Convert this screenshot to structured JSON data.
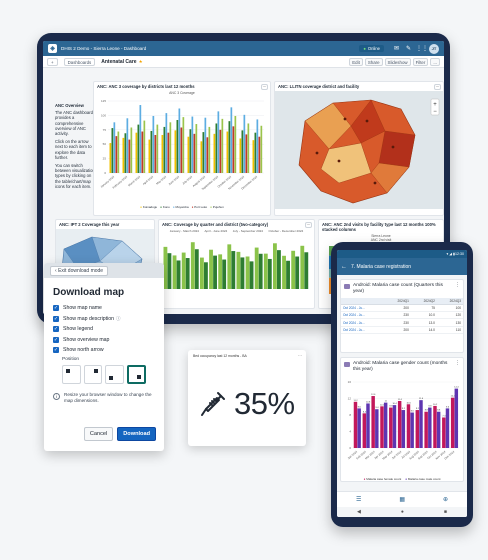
{
  "tablet": {
    "app_title": "DHIS 2 Demo - Sierra Leone - Dashboard",
    "online_label": "Online",
    "avatar_initials": "JT",
    "dashboards_btn": "Dashboards",
    "dashboard_name": "Antenatal Care",
    "actions": [
      "Edit",
      "Share",
      "Slideshow",
      "Filter",
      "..."
    ],
    "intro": {
      "heading": "ANC Overview",
      "paragraphs": [
        "The ANC dashboard provides a comprehensive overview of ANC activity.",
        "Click on the arrow next to each item to explore the data further.",
        "You can switch between visualization types by clicking on the table/chart/map icons for each item."
      ]
    },
    "cards": {
      "anc3_title": "ANC: ANC 3 coverage by districts last 12 months",
      "anc3_subtitle": "ANC 3 Coverage",
      "anc3_legend": [
        "Koinadugu",
        "Kono",
        "Moyamba",
        "Port Loko",
        "Pujehun"
      ],
      "map_title": "ANC: LLITN coverage district and facility",
      "ipt_title": "ANC: IPT 2 Coverage this year",
      "quarter_title": "ANC: Coverage by quarter and district (two-category)",
      "quarter_periods": [
        "January - March 2024",
        "April - June 2024",
        "July - September 2024",
        "October - December 2024"
      ],
      "visits_title": "ANC: ANC 2nd visits by facility type last 12 months 100% stacked columns",
      "visits_subtitle": "Sierra Leone",
      "visits_subtitle2": "ANC 2nd visit"
    }
  },
  "download_dialog": {
    "exit_label": "Exit download mode",
    "title": "Download map",
    "options": [
      "Show map name",
      "Show map description",
      "Show legend",
      "Show overview map",
      "Show north arrow"
    ],
    "position_label": "Position",
    "note": "Resize your browser window to change the map dimensions.",
    "cancel_label": "Cancel",
    "download_label": "Download"
  },
  "single_value": {
    "title": "Bed occupancy last 12 months - BA",
    "value": "35%"
  },
  "phone": {
    "time": "12:30",
    "screen_title": "7. Malaria case registration",
    "table_card_title": "Android: Malaria case count (Quarters this year)",
    "table_headers": [
      "",
      "2024Q1",
      "2024Q2",
      "2024Q3"
    ],
    "table_rows": [
      [
        "Oct 2024 - Ju...",
        "200",
        "75",
        "100"
      ],
      [
        "Oct 2024 - Ju...",
        "230",
        "10.0",
        "120"
      ],
      [
        "Oct 2024 - Ju...",
        "230",
        "13.0",
        "130"
      ],
      [
        "Oct 2024 - Ju...",
        "200",
        "14.0",
        "110"
      ]
    ],
    "chart_card_title": "Android: Malaria case gender count (months this year)",
    "chart_legend": [
      "Malaria case female count",
      "Malaria case male count"
    ]
  },
  "chart_data": [
    {
      "type": "bar",
      "title": "ANC: ANC 3 coverage by districts last 12 months",
      "subtitle": "ANC 3 Coverage",
      "categories": [
        "January 2024",
        "February 2024",
        "March 2024",
        "April 2024",
        "May 2024",
        "June 2024",
        "July 2024",
        "August 2024",
        "September 2024",
        "October 2024",
        "November 2024",
        "December 2024"
      ],
      "series": [
        {
          "name": "Koinadugu",
          "values": [
            52,
            61,
            70,
            58,
            66,
            74,
            63,
            55,
            68,
            72,
            60,
            57
          ]
        },
        {
          "name": "Kono",
          "values": [
            78,
            69,
            84,
            73,
            80,
            92,
            76,
            71,
            86,
            90,
            74,
            70
          ]
        },
        {
          "name": "Moyamba",
          "values": [
            88,
            95,
            118,
            99,
            104,
            112,
            98,
            96,
            107,
            114,
            101,
            93
          ]
        },
        {
          "name": "Port Loko",
          "values": [
            64,
            58,
            72,
            66,
            70,
            79,
            68,
            62,
            75,
            81,
            67,
            63
          ]
        },
        {
          "name": "Pujehun",
          "values": [
            72,
            79,
            91,
            84,
            88,
            97,
            85,
            80,
            94,
            99,
            86,
            82
          ]
        }
      ],
      "ylim": [
        0,
        125
      ]
    },
    {
      "type": "bar",
      "title": "Android: Malaria case gender count (months this year)",
      "categories": [
        "Jan 2024",
        "Feb 2024",
        "Mar 2024",
        "Apr 2024",
        "May 2024",
        "Jun 2024",
        "Jul 2024",
        "Aug 2024",
        "Sep 2024",
        "Oct 2024",
        "Nov 2024",
        "Dec 2024"
      ],
      "series": [
        {
          "name": "Malaria case female count",
          "values": [
            11.2,
            8.4,
            12.6,
            10.1,
            9.8,
            11.4,
            10.6,
            9.2,
            8.8,
            10.2,
            7.4,
            12.2
          ]
        },
        {
          "name": "Malaria case male count",
          "values": [
            9.6,
            10.8,
            9.4,
            11.0,
            10.4,
            9.2,
            8.6,
            11.6,
            9.8,
            8.8,
            9.6,
            14.4
          ]
        }
      ],
      "ylim": [
        0,
        16
      ]
    }
  ],
  "colors": {
    "header": "#2c6693",
    "primary_button": "#1565c0",
    "female_series": "#c2185b",
    "male_series": "#5e35b1"
  }
}
